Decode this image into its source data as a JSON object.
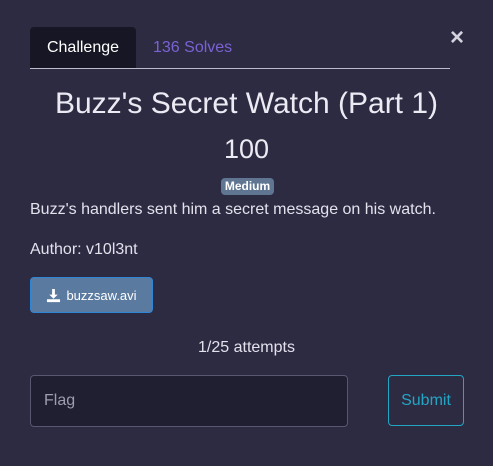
{
  "modal": {
    "close_symbol": "×",
    "tabs": [
      {
        "label": "Challenge"
      },
      {
        "label": "136 Solves"
      }
    ],
    "title": "Buzz's Secret Watch (Part 1)",
    "points": "100",
    "difficulty": "Medium",
    "description": "Buzz's handlers sent him a secret message on his watch.",
    "author": "Author: v10l3nt",
    "file": {
      "label": "buzzsaw.avi",
      "icon": "download-icon"
    },
    "attempts": "1/25 attempts",
    "flag_input": {
      "placeholder": "Flag",
      "value": ""
    },
    "submit_label": "Submit"
  },
  "colors": {
    "background": "#2d2b42",
    "tab_active_bg": "#161624",
    "solves_link": "#7a62d3",
    "badge_bg": "#5f7592",
    "file_button_bg": "#5b7a9f",
    "submit_accent": "#23a5c4"
  }
}
